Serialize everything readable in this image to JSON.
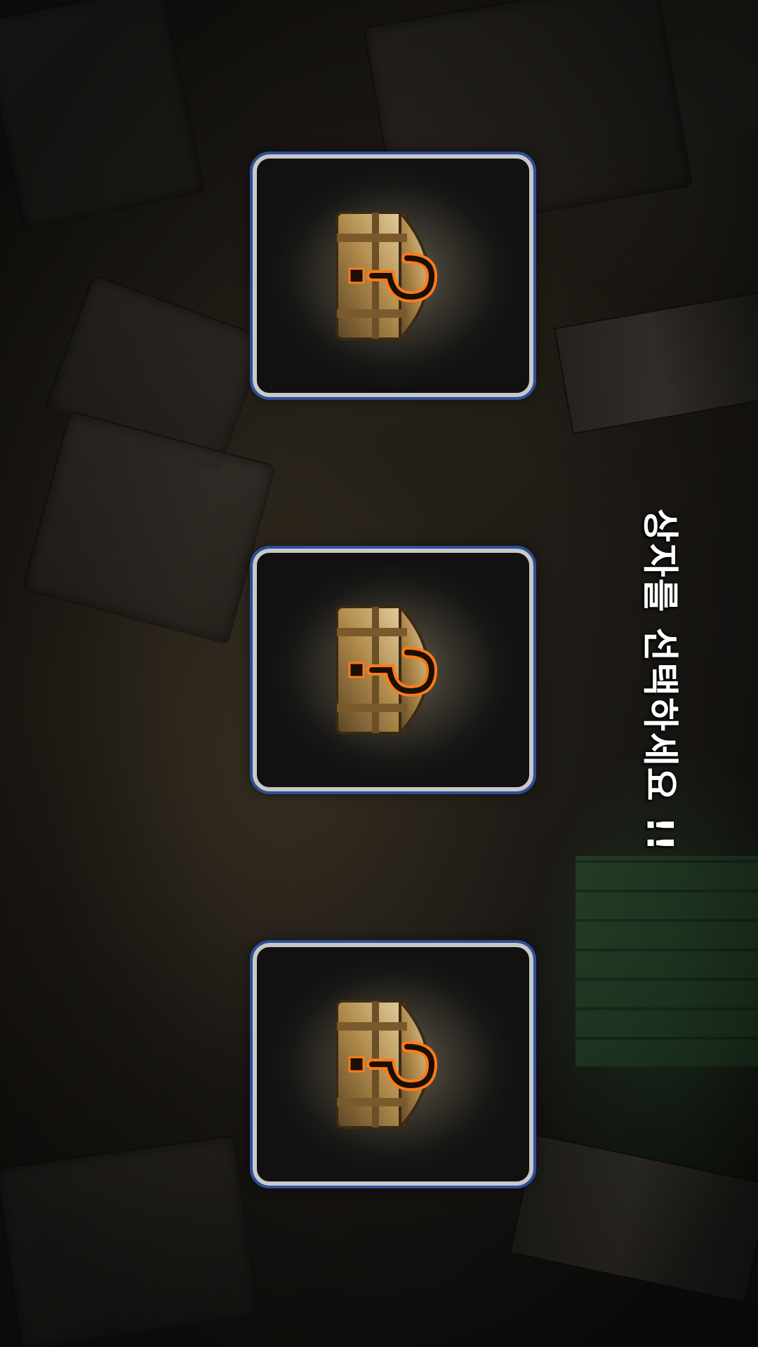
{
  "prompt": {
    "text": "상자를 선택하세요 !!"
  },
  "chests": [
    {
      "label": "",
      "icon": "treasure-chest-icon"
    },
    {
      "label": "",
      "icon": "treasure-chest-icon"
    },
    {
      "label": "",
      "icon": "treasure-chest-icon"
    }
  ],
  "colors": {
    "card_border": "#c8c8c8",
    "card_outline": "#2d4f98",
    "text": "#ffffff",
    "chest_gold": "#c9a35a",
    "chest_glow": "#ff7a1a"
  }
}
